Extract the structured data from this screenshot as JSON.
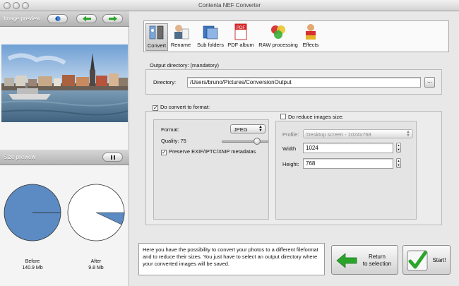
{
  "window": {
    "title": "Contenta NEF Converter"
  },
  "left_panel": {
    "image_preview_label": "Image preview",
    "size_preview_label": "Size preview",
    "before": {
      "label": "Before",
      "value": "140.9 Mb"
    },
    "after": {
      "label": "After",
      "value": "9.8 Mb",
      "fraction": 0.07
    }
  },
  "toolbar": {
    "items": [
      {
        "label": "Convert",
        "icon": "convert-icon"
      },
      {
        "label": "Rename",
        "icon": "rename-icon"
      },
      {
        "label": "Sub folders",
        "icon": "folders-icon"
      },
      {
        "label": "PDF album",
        "icon": "pdf-icon"
      },
      {
        "label": "RAW processing",
        "icon": "raw-processing-icon"
      },
      {
        "label": "Effects",
        "icon": "effects-icon"
      }
    ],
    "active": "Convert"
  },
  "output": {
    "section_label": "Output directory: (mandatory)",
    "directory_label": "Directory:",
    "directory_value": "/Users/bruno/Pictures/ConversionOutput",
    "browse_label": "..."
  },
  "convert": {
    "checkbox_label": "Do convert to format:",
    "checked": true,
    "format_label": "Format:",
    "format_value": "JPEG",
    "quality_label": "Quality: 75",
    "quality_value": 75,
    "preserve_label": "Preserve EXIF/IPTC/XMP metadatas",
    "preserve_checked": true
  },
  "reduce": {
    "checkbox_label": "Do reduce images size:",
    "checked": false,
    "profile_label": "Profile:",
    "profile_value": "Desktop screen - 1024x768",
    "width_label": "Width",
    "width_value": "1024",
    "height_label": "Height:",
    "height_value": "768"
  },
  "info_text": "Here you have the possibility to convert your photos to a different fileformat and to reduce their sizes. You just have to select an output directory where your converted images will be saved.",
  "buttons": {
    "return_line1": "Return",
    "return_line2": "to selection",
    "start": "Start!"
  },
  "colors": {
    "pie_fill": "#5b8bc2",
    "arrow_green": "#2aa52a"
  }
}
